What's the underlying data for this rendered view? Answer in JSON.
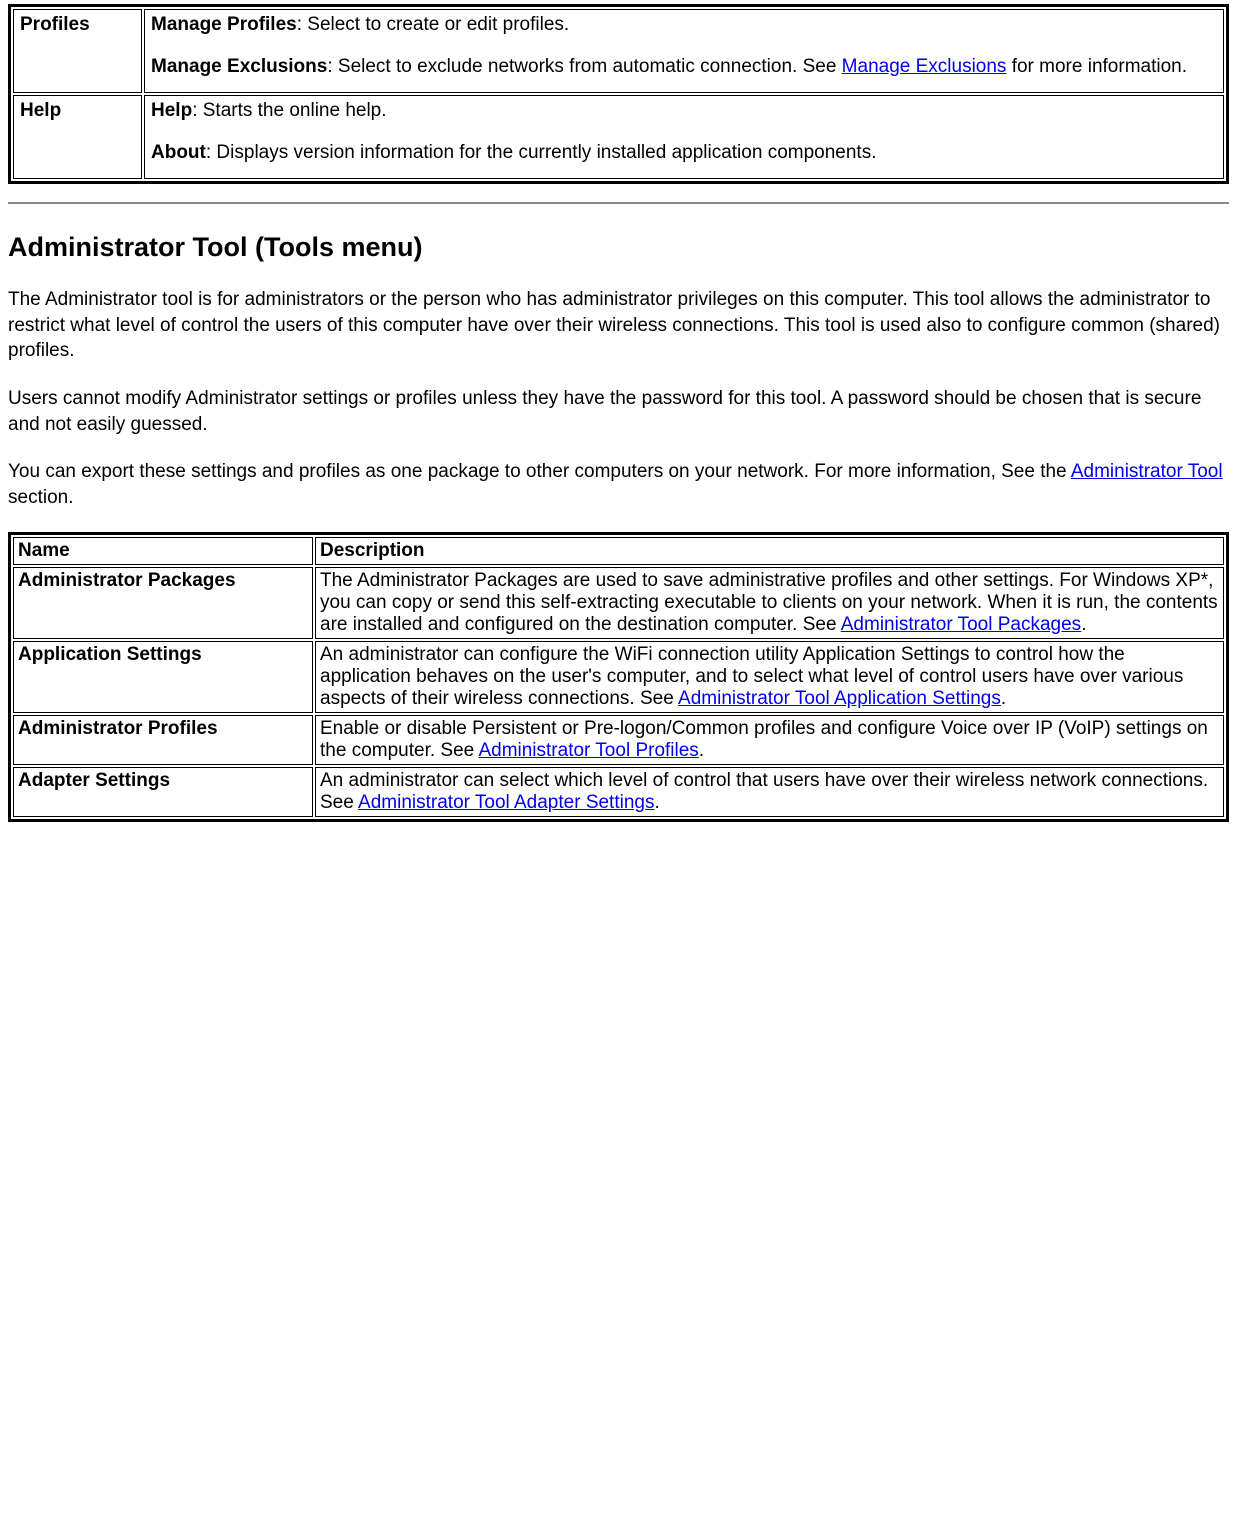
{
  "topTable": {
    "rows": [
      {
        "label": "Profiles",
        "items": [
          {
            "bold": "Manage Profiles",
            "text": ": Select to create or edit profiles.",
            "link": null,
            "linkText": null,
            "suffix": null
          },
          {
            "bold": "Manage Exclusions",
            "text": ": Select to exclude networks from automatic connection. See ",
            "link": "#",
            "linkText": "Manage Exclusions",
            "suffix": " for more information."
          }
        ]
      },
      {
        "label": "Help",
        "items": [
          {
            "bold": "Help",
            "text": ": Starts the online help.",
            "link": null,
            "linkText": null,
            "suffix": null
          },
          {
            "bold": "About",
            "text": ": Displays version information for the currently installed application components.",
            "link": null,
            "linkText": null,
            "suffix": null
          }
        ]
      }
    ]
  },
  "section": {
    "heading": "Administrator Tool (Tools menu)",
    "p1": "The Administrator tool is for administrators or the person who has administrator privileges on this computer. This tool allows the administrator to restrict what level of control the users of this computer have over their wireless connections. This tool is used also to configure common (shared) profiles.",
    "p2": "Users cannot modify Administrator settings or profiles unless they have the password for this tool. A password should be chosen that is secure and not easily guessed.",
    "p3_pre": "You can export these settings and profiles as one package to other computers on your network. For more information, See the ",
    "p3_link": "Administrator Tool",
    "p3_post": " section."
  },
  "adminTable": {
    "headers": {
      "name": "Name",
      "desc": "Description"
    },
    "rows": [
      {
        "name": "Administrator Packages",
        "desc_pre": "The Administrator Packages are used to save administrative profiles and other settings. For Windows XP*, you can copy or send this self-extracting executable to clients on your network. When it is run, the contents are installed and configured on the destination computer. See ",
        "link": "Administrator Tool Packages",
        "desc_post": "."
      },
      {
        "name": "Application Settings",
        "desc_pre": "An administrator can configure the WiFi connection utility Application Settings to control how the application behaves on the user's computer, and to select what level of control users have over various aspects of their wireless connections. See ",
        "link": "Administrator Tool Application Settings",
        "desc_post": "."
      },
      {
        "name": "Administrator Profiles",
        "desc_pre": "Enable or disable Persistent or Pre-logon/Common profiles and configure Voice over IP (VoIP) settings on the computer. See ",
        "link": "Administrator Tool Profiles",
        "desc_post": "."
      },
      {
        "name": "Adapter Settings",
        "desc_pre": "An administrator can select which level of control that users have over their wireless network connections. See ",
        "link": "Administrator Tool Adapter Settings",
        "desc_post": "."
      }
    ]
  }
}
